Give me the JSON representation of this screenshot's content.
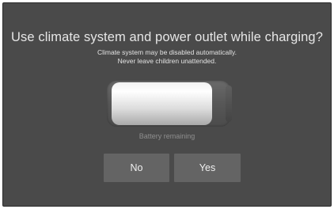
{
  "dialog": {
    "title": "Use climate system and power outlet while charging?",
    "subtitle_line1": "Climate system may be disabled automatically.",
    "subtitle_line2": "Never leave children unattended."
  },
  "battery": {
    "label": "Battery remaining",
    "level_fraction": 0.88
  },
  "buttons": {
    "no_label": "No",
    "yes_label": "Yes"
  },
  "colors": {
    "background": "#4a4a4a",
    "button": "#646464",
    "text": "#e6e6e6",
    "muted_text": "#8e8e8e"
  }
}
